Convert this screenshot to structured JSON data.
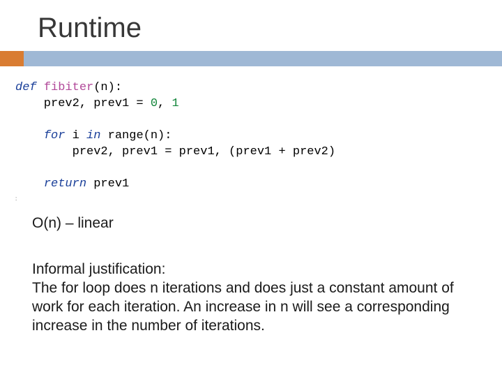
{
  "title": "Runtime",
  "code": {
    "kw_def": "def",
    "fn_name": "fibiter",
    "l1_rest": "(n):",
    "l2": "    prev2, prev1 = ",
    "l2_n0": "0",
    "l2_mid": ", ",
    "l2_n1": "1",
    "kw_for": "for",
    "l3_mid": " i ",
    "kw_in": "in",
    "l3_rest": " range(n):",
    "l4": "        prev2, prev1 = prev1, (prev1 + prev2)",
    "kw_return": "return",
    "l5_rest": " prev1"
  },
  "complexity": "O(n) – linear",
  "justification_label": "Informal justification:",
  "justification_body": "The for loop does n iterations and does just a constant amount of work for each iteration.  An increase in n will see a corresponding increase in the number of iterations."
}
